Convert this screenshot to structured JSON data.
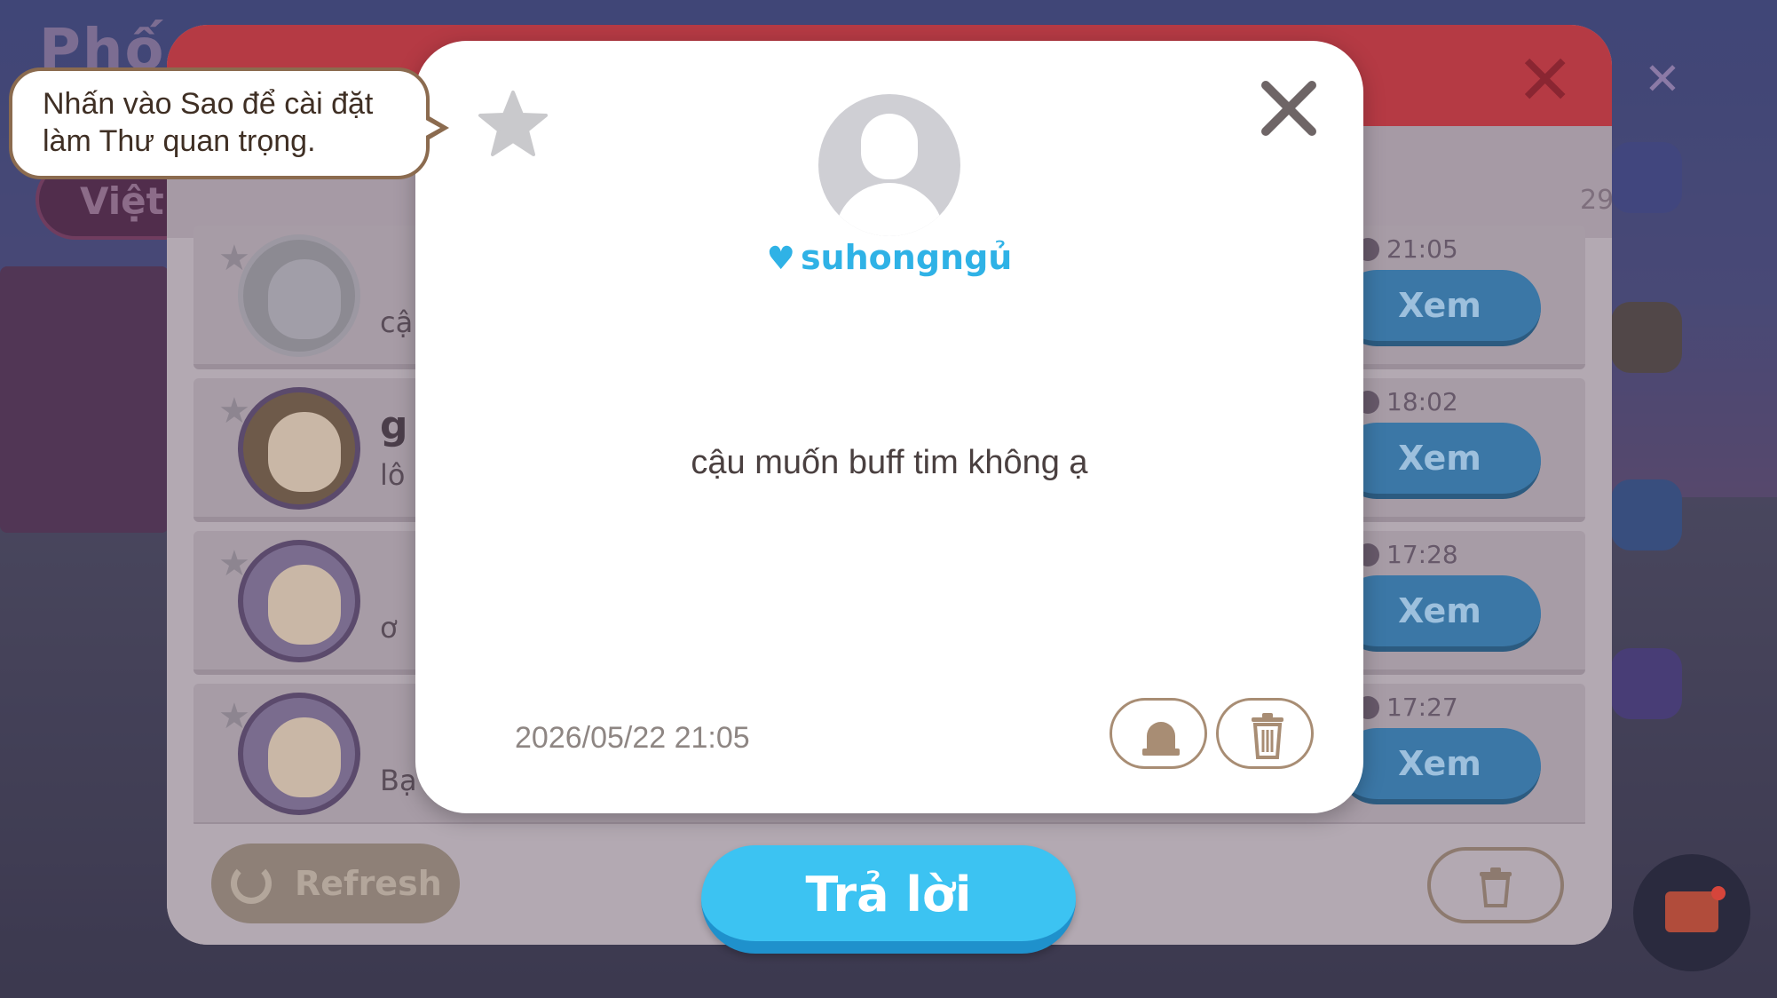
{
  "tooltip": {
    "text": "Nhấn vào Sao để cài đặt làm Thư quan trọng."
  },
  "modal": {
    "sender_name": "suhongngủ",
    "message": "cậu muốn buff tim không ạ",
    "datetime": "2026/05/22 21:05",
    "icons": {
      "star": "star-icon",
      "close": "close-icon",
      "report": "siren-icon",
      "delete": "trash-icon",
      "sender_badge": "heart-icon"
    }
  },
  "reply_button": {
    "label": "Trả lời"
  },
  "mail_panel": {
    "count": "29",
    "rows": [
      {
        "time": "21:05",
        "view_label": "Xem",
        "snippet": "cậ"
      },
      {
        "time": "18:02",
        "view_label": "Xem",
        "title": "g",
        "snippet": "lô"
      },
      {
        "time": "17:28",
        "view_label": "Xem",
        "snippet": "ơ"
      },
      {
        "time": "17:27",
        "view_label": "Xem",
        "snippet": "Bạ"
      }
    ],
    "refresh_label": "Refresh"
  },
  "background": {
    "title_fragment": "Phố",
    "lang_fragment": "Việt"
  },
  "colors": {
    "accent_blue": "#3cc3f2",
    "sender_blue": "#2fb2e6",
    "modal_bg": "#ffffff",
    "header_red": "#b53a44",
    "tooltip_border": "#8b6b4f"
  }
}
